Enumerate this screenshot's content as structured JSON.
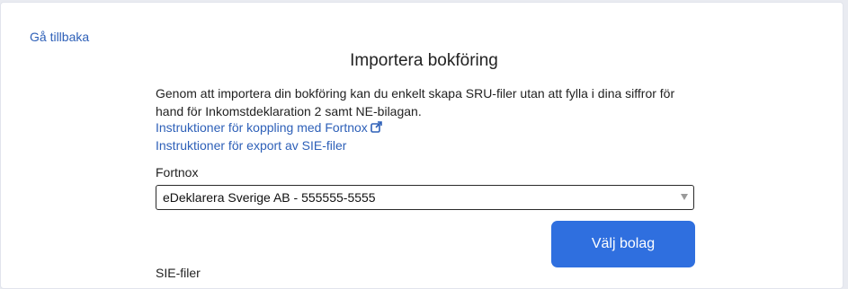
{
  "nav": {
    "back_label": "Gå tillbaka"
  },
  "page": {
    "title": "Importera bokföring",
    "intro": "Genom att importera din bokföring kan du enkelt skapa SRU-filer utan att fylla i dina siffror för hand för Inkomstdeklaration 2 samt NE-bilagan."
  },
  "links": {
    "fortnox_instructions": "Instruktioner för koppling med Fortnox",
    "sie_instructions": "Instruktioner för export av SIE-filer"
  },
  "fortnox": {
    "label": "Fortnox",
    "selected_company": "eDeklarera Sverige AB - 555555-5555",
    "select_button": "Välj bolag"
  },
  "sie": {
    "label": "SIE-filer"
  },
  "icons": {
    "external_link": "external-link-icon",
    "dropdown": "chevron-down-icon"
  },
  "colors": {
    "link": "#2e60b8",
    "primary": "#2f6fdf",
    "background": "#e9ebf1"
  }
}
